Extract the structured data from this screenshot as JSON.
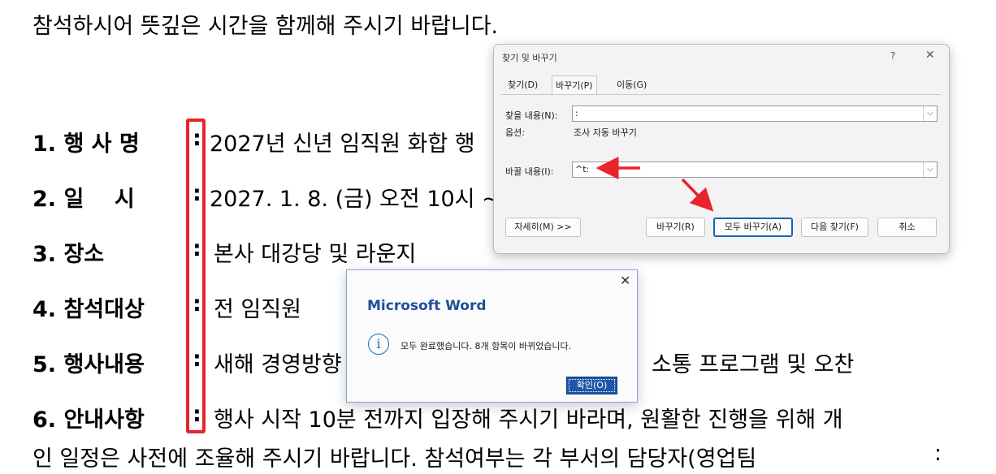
{
  "document": {
    "intro": "참석하시어 뜻깊은 시간을 함께해 주시기 바랍니다.",
    "items": [
      {
        "label": "1. 행 사 명",
        "colon": ":",
        "value": "2027년 신년 임직원 화합 행"
      },
      {
        "label": "2. 일    시",
        "colon": ":",
        "value": "2027. 1. 8. (금) 오전 10시 ~"
      },
      {
        "label": "3. 장소",
        "colon": ":",
        "value": "본사 대강당 및 라운지"
      },
      {
        "label": "4. 참석대상",
        "colon": ":",
        "value": "전 임직원"
      },
      {
        "label": "5. 행사내용",
        "colon": ":",
        "value": "새해 경영방향"
      },
      {
        "label": "6. 안내사항",
        "colon": ":",
        "value": "행사 시작 10분 전까지 입장해 주시기 바라며, 원활한 진행을 위해 개"
      }
    ],
    "item5_tail": "소통 프로그램 및 오찬",
    "last_line": "인 일정은 사전에 조율해 주시기 바랍니다. 참석여부는 각 부서의 담당자(영업팀",
    "last_line_colon": ":"
  },
  "find_replace": {
    "title": "찾기 및 바꾸기",
    "help": "?",
    "close": "✕",
    "tabs": [
      "찾기(D)",
      "바꾸기(P)",
      "이동(G)"
    ],
    "find_label": "찾을 내용(N):",
    "find_value": ":",
    "options_label": "옵션:",
    "options_value": "조사 자동 바꾸기",
    "replace_label": "바꿀 내용(I):",
    "replace_value": "^t:",
    "dropdown_glyph": "⌵",
    "more_button": "자세히(M) >>",
    "replace_button": "바꾸기(R)",
    "replace_all_button": "모두 바꾸기(A)",
    "find_next_button": "다음 찾기(F)",
    "cancel_button": "취소"
  },
  "message_box": {
    "title": "Microsoft Word",
    "close": "✕",
    "icon": "info-icon",
    "icon_glyph": "i",
    "text": "모두 완료했습니다. 8개 항목이 바뀌었습니다.",
    "ok_button": "확인(O)"
  },
  "colors": {
    "highlight_red": "#e8242c",
    "word_blue": "#1f4e9a",
    "ok_button_blue": "#1e56a8"
  }
}
